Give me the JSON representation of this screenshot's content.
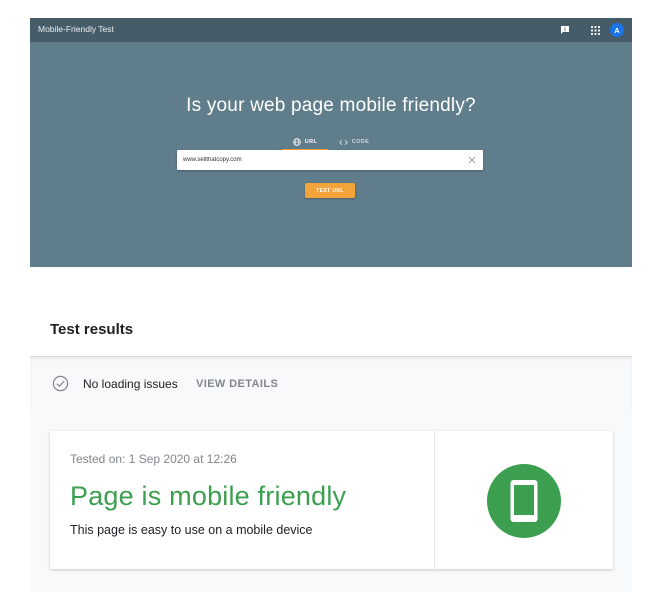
{
  "app": {
    "title": "Mobile-Friendly Test",
    "avatar_initial": "A"
  },
  "icons": {
    "feedback": "feedback-icon",
    "apps": "apps-grid-icon",
    "url_tab": "globe-icon",
    "code_tab": "code-icon",
    "clear": "close-icon",
    "status": "check-circle-icon",
    "result": "mobile-phone-icon"
  },
  "hero": {
    "heading": "Is your web page mobile friendly?",
    "tabs": [
      {
        "label": "URL",
        "active": true
      },
      {
        "label": "CODE",
        "active": false
      }
    ],
    "url_value": "www.sellthatcopy.com",
    "test_button": "TEST URL"
  },
  "results": {
    "title": "Test results",
    "status_text": "No loading issues",
    "view_details": "VIEW DETAILS",
    "tested_on": "Tested on: 1 Sep 2020 at 12:26",
    "heading": "Page is mobile friendly",
    "description": "This page is easy to use on a mobile device"
  },
  "colors": {
    "topbar": "#465d69",
    "hero": "#607d8b",
    "accent": "#f2a33a",
    "success": "#3c9f50",
    "avatar": "#1a73e8"
  }
}
